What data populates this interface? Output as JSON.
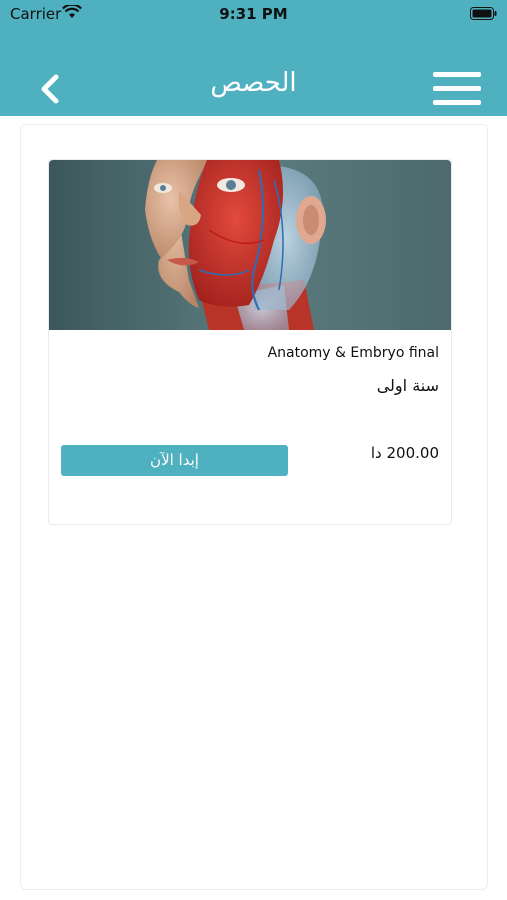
{
  "status_bar": {
    "carrier": "Carrier",
    "time": "9:31 PM"
  },
  "header": {
    "title": "الحصص",
    "back_icon": "chevron-left-icon",
    "menu_icon": "hamburger-menu-icon",
    "color": "#4fb1c0"
  },
  "courses": [
    {
      "title": "Anatomy & Embryo final",
      "year": "سنة اولى",
      "price": "200.00 دا",
      "button_label": "إبدا الآن"
    }
  ]
}
